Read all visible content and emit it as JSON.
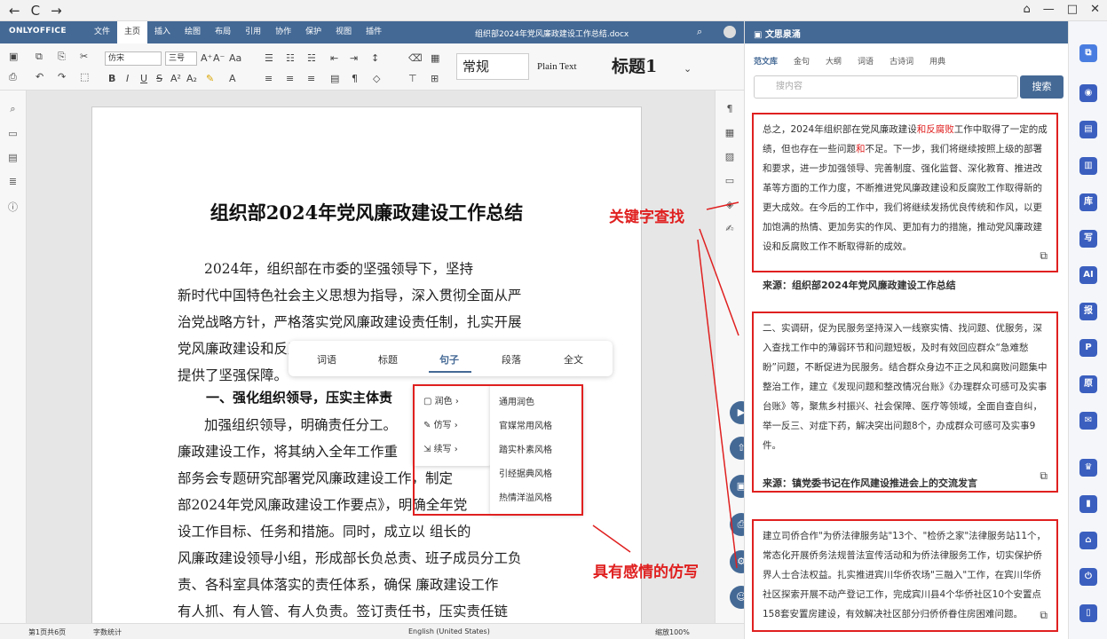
{
  "titlebar": {
    "back": "←",
    "refresh": "C",
    "forward": "→",
    "home": "⌂",
    "minimize": "—",
    "maximize": "□",
    "close": "✕"
  },
  "app": {
    "logo": "ONLYOFFICE",
    "tabs": [
      "文件",
      "主页",
      "插入",
      "绘图",
      "布局",
      "引用",
      "协作",
      "保护",
      "视图",
      "插件"
    ],
    "doc_title": "组织部2024年党风廉政建设工作总结.docx",
    "font": "仿宋",
    "size": "三号",
    "styles": [
      "常规",
      "Plain Text",
      "标题1"
    ]
  },
  "document": {
    "title": "组织部2024年党风廉政建设工作总结",
    "title_blur": "部",
    "lines": [
      "2024年，组织部在市委的坚强领导下，坚持",
      "新时代中国特色社会主义思想为指导，深入贯彻全面从严",
      "治党战略方针，严格落实党风廉政建设责任制，扎实开展",
      "党风廉政建设和反腐败工作，为推动组织工作高质量发展",
      "提供了坚强保障。"
    ],
    "h2": "一、强化组织领导，压实主体责",
    "lines2": [
      "加强组织领导，明确责任分工。",
      "廉政建设工作，将其纳入全年工作重",
      "部务会专题研究部署党风廉政建设工作，制定",
      "部2024年党风廉政建设工作要点》，明确全年党",
      "设工作目标、任务和措施。同时，成立以    组长的",
      "风廉政建设领导小组，形成部长负总责、班子成员分工负",
      "责、各科室具体落实的责任体系，确保   廉政建设工作",
      "有人抓、有人管、有人负责。签订责任书，压实责任链"
    ]
  },
  "popup": {
    "options": [
      "词语",
      "标题",
      "句子",
      "段落",
      "全文"
    ],
    "active": "句子"
  },
  "submenu": [
    "润色",
    "仿写",
    "续写"
  ],
  "style_options": [
    "通用润色",
    "官媒常用风格",
    "踏实朴素风格",
    "引经据典风格",
    "热情洋溢风格"
  ],
  "annotations": {
    "keyword": "关键字查找",
    "emotion": "具有感情的仿写"
  },
  "statusbar": {
    "page": "第1页共6页",
    "wordcount": "字数统计",
    "lang": "English (United States)",
    "zoom": "缩放100%"
  },
  "panel": {
    "title": "文思泉涌",
    "tabs": [
      "范文库",
      "金句",
      "大纲",
      "词语",
      "古诗词",
      "用典"
    ],
    "search_placeholder": "搜内容",
    "search_btn": "搜索",
    "cards": [
      {
        "pre": "总之，2024年组织部在党风廉政建设",
        "hl1": "和反腐败",
        "mid": "工作中取得了一定的成绩，但也存在一些问题",
        "hl2": "和",
        "post": "不足。下一步，我们将继续按照上级的部署和要求，进一步加强领导、完善制度、强化监督、深化教育、推进改革等方面的工作力度，不断推进党风廉政建设和反腐败工作取得新的更大成效。在今后的工作中，我们将继续发扬优良传统和作风，以更加饱满的热情、更加务实的作风、更加有力的措施，推动党风廉政建设和反腐败工作不断取得新的成效。",
        "source": "来源：组织部2024年党风廉政建设工作总结"
      },
      {
        "text": "二、实调研，促为民服务坚持深入一线察实情、找问题、优服务，深入查找工作中的薄弱环节和问题短板，及时有效回应群众“急难愁盼”问题，不断促进为民服务。结合群众身边不正之风和腐败问题集中整治工作，建立《发现问题和整改情况台账》《办理群众可感可及实事台账》等，聚焦乡村振兴、社会保障、医疗等领域，全面自查自纠，举一反三、对症下药，解决突出问题8个，办成群众可感可及实事9件。",
        "source": "来源：镇党委书记在作风建设推进会上的交流发言"
      },
      {
        "text": "建立司侨合作\"为侨法律服务站\"13个、\"检侨之家\"法律服务站11个，常态化开展侨务法规普法宣传活动和为侨法律服务工作，切实保护侨界人士合法权益。扎实推进宾川华侨农场\"三融入\"工作，在宾川华侨社区探索开展不动产登记工作，完成宾川县4个华侨社区10个安置点158套安置房建设，有效解决社区部分归侨侨眷住房困难问题。"
      }
    ]
  }
}
